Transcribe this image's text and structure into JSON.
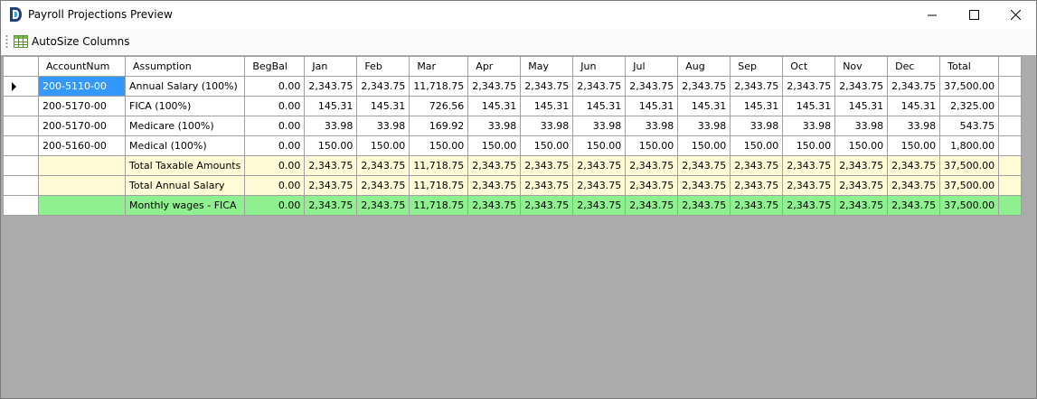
{
  "window": {
    "title": "Payroll Projections Preview"
  },
  "toolbar": {
    "autosize_label": "AutoSize Columns"
  },
  "grid": {
    "columns": [
      "AccountNum",
      "Assumption",
      "BegBal",
      "Jan",
      "Feb",
      "Mar",
      "Apr",
      "May",
      "Jun",
      "Jul",
      "Aug",
      "Sep",
      "Oct",
      "Nov",
      "Dec",
      "Total"
    ],
    "rows": [
      [
        "200-5110-00",
        "Annual Salary (100%)",
        "0.00",
        "2,343.75",
        "2,343.75",
        "11,718.75",
        "2,343.75",
        "2,343.75",
        "2,343.75",
        "2,343.75",
        "2,343.75",
        "2,343.75",
        "2,343.75",
        "2,343.75",
        "2,343.75",
        "37,500.00"
      ],
      [
        "200-5170-00",
        "FICA (100%)",
        "0.00",
        "145.31",
        "145.31",
        "726.56",
        "145.31",
        "145.31",
        "145.31",
        "145.31",
        "145.31",
        "145.31",
        "145.31",
        "145.31",
        "145.31",
        "2,325.00"
      ],
      [
        "200-5170-00",
        "Medicare (100%)",
        "0.00",
        "33.98",
        "33.98",
        "169.92",
        "33.98",
        "33.98",
        "33.98",
        "33.98",
        "33.98",
        "33.98",
        "33.98",
        "33.98",
        "33.98",
        "543.75"
      ],
      [
        "200-5160-00",
        "Medical (100%)",
        "0.00",
        "150.00",
        "150.00",
        "150.00",
        "150.00",
        "150.00",
        "150.00",
        "150.00",
        "150.00",
        "150.00",
        "150.00",
        "150.00",
        "150.00",
        "1,800.00"
      ],
      [
        "",
        "Total Taxable Amounts",
        "0.00",
        "2,343.75",
        "2,343.75",
        "11,718.75",
        "2,343.75",
        "2,343.75",
        "2,343.75",
        "2,343.75",
        "2,343.75",
        "2,343.75",
        "2,343.75",
        "2,343.75",
        "2,343.75",
        "37,500.00"
      ],
      [
        "",
        "Total Annual Salary",
        "0.00",
        "2,343.75",
        "2,343.75",
        "11,718.75",
        "2,343.75",
        "2,343.75",
        "2,343.75",
        "2,343.75",
        "2,343.75",
        "2,343.75",
        "2,343.75",
        "2,343.75",
        "2,343.75",
        "37,500.00"
      ],
      [
        "",
        "Monthly wages - FICA",
        "0.00",
        "2,343.75",
        "2,343.75",
        "11,718.75",
        "2,343.75",
        "2,343.75",
        "2,343.75",
        "2,343.75",
        "2,343.75",
        "2,343.75",
        "2,343.75",
        "2,343.75",
        "2,343.75",
        "37,500.00"
      ]
    ]
  },
  "icons": {
    "app": "app-logo-icon",
    "minimize": "minimize-icon",
    "maximize": "maximize-icon",
    "close": "close-icon",
    "autosize": "table-grid-icon",
    "current_row": "current-row-arrow-icon"
  },
  "colors": {
    "selection": "#3399ff",
    "total_row": "#fffbd6",
    "highlight_row": "#8ef08e",
    "workspace": "#ababab"
  }
}
